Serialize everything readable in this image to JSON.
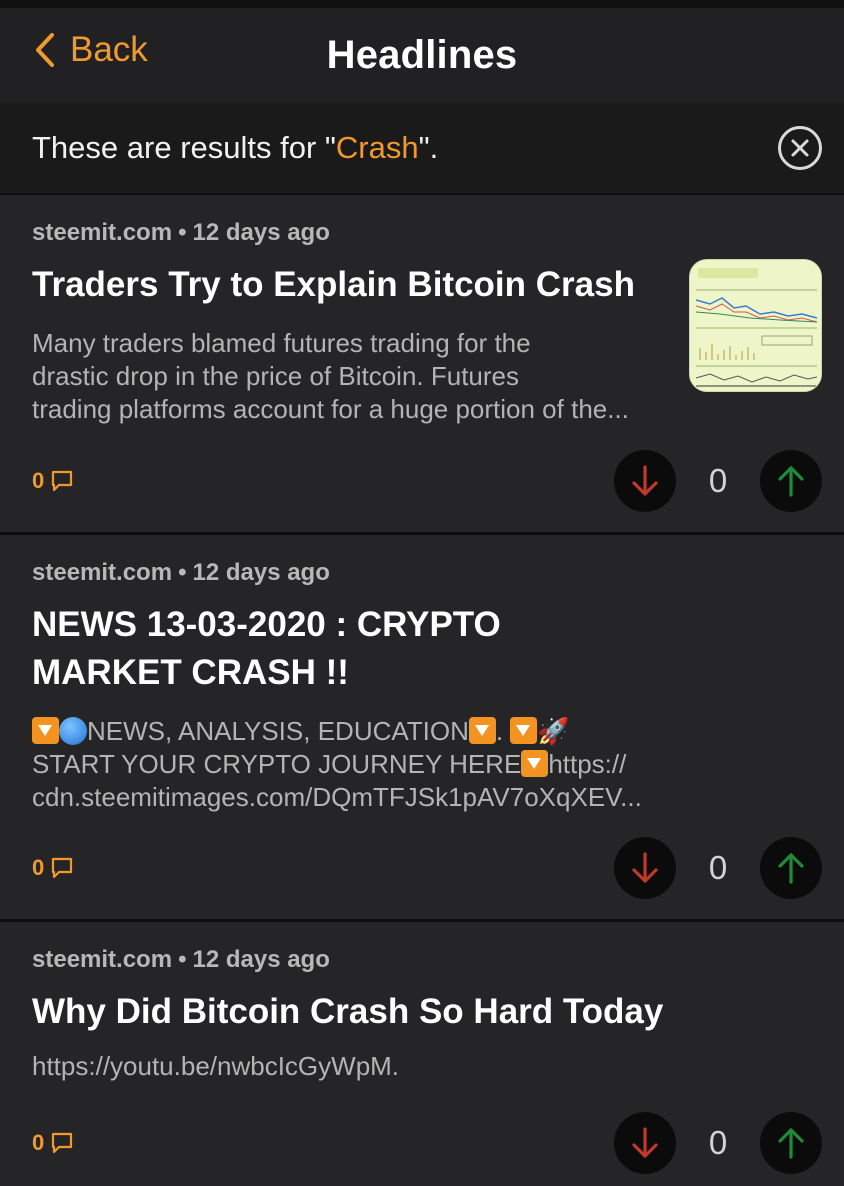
{
  "nav": {
    "back_label": "Back",
    "title": "Headlines"
  },
  "search": {
    "prefix": "These are results for \"",
    "query": "Crash",
    "suffix": "\"."
  },
  "colors": {
    "accent": "#f19a2b",
    "downvote": "#c0392b",
    "upvote": "#1e8a3a"
  },
  "posts": [
    {
      "source": "steemit.com",
      "dot": "•",
      "age": "12 days ago",
      "title": "Traders Try to Explain Bitcoin Crash",
      "excerpt_lines": [
        "Many traders blamed futures trading for the",
        "drastic drop in the price of Bitcoin. Futures",
        "trading platforms account for a huge portion of the..."
      ],
      "comments": "0",
      "score": "0",
      "thumbnail": "chart-thumbnail"
    },
    {
      "source": "steemit.com",
      "dot": "•",
      "age": "12 days ago",
      "title_lines": [
        "NEWS 13-03-2020 : CRYPTO",
        "MARKET CRASH !!"
      ],
      "excerpt_parts": {
        "p1": "NEWS, ANALYSIS, EDUCATION",
        "p2": ". ",
        "rocket": "🚀",
        "p3": "START YOUR CRYPTO JOURNEY HERE",
        "p4": "https://",
        "p5": "cdn.steemitimages.com/DQmTFJSk1pAV7oXqXEV..."
      },
      "comments": "0",
      "score": "0"
    },
    {
      "source": "steemit.com",
      "dot": "•",
      "age": "12 days ago",
      "title": "Why Did Bitcoin Crash So Hard Today",
      "excerpt_lines": [
        "https://youtu.be/nwbcIcGyWpM."
      ],
      "comments": "0",
      "score": "0"
    }
  ]
}
